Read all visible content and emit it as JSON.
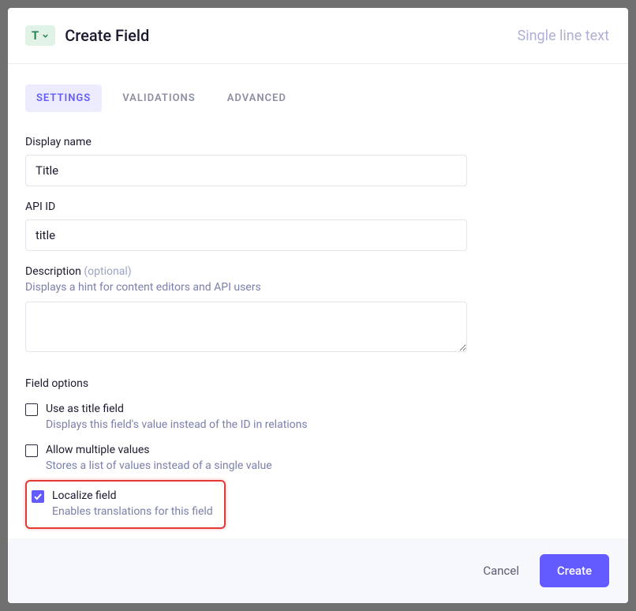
{
  "header": {
    "type_letter": "T",
    "title": "Create Field",
    "field_type": "Single line text"
  },
  "tabs": {
    "settings": "SETTINGS",
    "validations": "VALIDATIONS",
    "advanced": "ADVANCED"
  },
  "form": {
    "display_name_label": "Display name",
    "display_name_value": "Title",
    "api_id_label": "API ID",
    "api_id_value": "title",
    "description_label": "Description",
    "description_optional": "(optional)",
    "description_hint": "Displays a hint for content editors and API users",
    "description_value": "",
    "field_options_title": "Field options",
    "options": {
      "use_as_title": {
        "label": "Use as title field",
        "hint": "Displays this field's value instead of the ID in relations",
        "checked": false
      },
      "allow_multiple": {
        "label": "Allow multiple values",
        "hint": "Stores a list of values instead of a single value",
        "checked": false
      },
      "localize": {
        "label": "Localize field",
        "hint": "Enables translations for this field",
        "checked": true
      }
    }
  },
  "footer": {
    "cancel": "Cancel",
    "create": "Create"
  }
}
